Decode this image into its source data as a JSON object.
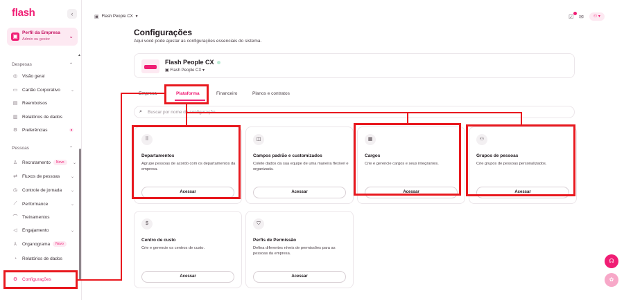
{
  "brand": {
    "logo": "flash",
    "accent": "#f01d74",
    "highlight": "#e8181e"
  },
  "sidebar": {
    "collapse_label": "‹",
    "profile": {
      "name": "Perfil da Empresa",
      "role": "Admin ou gestor"
    },
    "sections": [
      {
        "title": "Despesas",
        "items": [
          {
            "label": "Visão geral",
            "icon": "eye-icon"
          },
          {
            "label": "Cartão Corporativo",
            "icon": "card-icon",
            "has_chevron": true
          },
          {
            "label": "Reembolsos",
            "icon": "receipt-icon"
          },
          {
            "label": "Relatórios de dados",
            "icon": "report-icon"
          },
          {
            "label": "Preferências",
            "icon": "preferences-icon",
            "has_dot": true
          }
        ]
      },
      {
        "title": "Pessoas",
        "items": [
          {
            "label": "Recrutamento",
            "icon": "recruit-icon",
            "badge": "Novo",
            "has_chevron": true
          },
          {
            "label": "Fluxos de pessoas",
            "icon": "flow-icon",
            "has_chevron": true
          },
          {
            "label": "Controle de jornada",
            "icon": "clock-icon",
            "has_chevron": true
          },
          {
            "label": "Performance",
            "icon": "performance-icon",
            "has_chevron": true
          },
          {
            "label": "Treinamentos",
            "icon": "training-icon"
          },
          {
            "label": "Engajamento",
            "icon": "engagement-icon",
            "has_chevron": true
          },
          {
            "label": "Organograma",
            "icon": "org-icon",
            "badge": "Novo"
          },
          {
            "label": "Relatórios de dados",
            "icon": "report-icon"
          }
        ]
      }
    ],
    "active_item": {
      "label": "Configurações",
      "icon": "gear-icon"
    }
  },
  "topbar": {
    "company_selector": "Flash People CX",
    "avatar": "⚇ ▾"
  },
  "main": {
    "title": "Configurações",
    "subtitle": "Aqui você pode ajustar as configurações essenciais do sistema.",
    "company": {
      "name": "Flash People CX",
      "selector": "Flash People CX"
    },
    "tabs": [
      {
        "label": "Empresa",
        "active": false
      },
      {
        "label": "Plataforma",
        "active": true
      },
      {
        "label": "Financeiro",
        "active": false
      },
      {
        "label": "Planos e contratos",
        "active": false
      }
    ],
    "search_placeholder": "Buscar por nome da configuração",
    "cards": [
      {
        "icon": "grid-icon",
        "title": "Departamentos",
        "desc": "Agrupe pessoas de acordo com os departamentos da empresa.",
        "button": "Acessar"
      },
      {
        "icon": "fields-icon",
        "title": "Campos padrão e customizados",
        "desc": "Colete dados da sua equipe de uma maneira flexível e organizada.",
        "button": "Acessar"
      },
      {
        "icon": "briefcase-icon",
        "title": "Cargos",
        "desc": "Crie e gerencie cargos e seus integrantes.",
        "button": "Acessar"
      },
      {
        "icon": "people-icon",
        "title": "Grupos de pessoas",
        "desc": "Crie grupos de pessoas personalizados.",
        "button": "Acessar"
      },
      {
        "icon": "coin-icon",
        "title": "Centro de custo",
        "desc": "Crie e gerencie os centros de custo.",
        "button": "Acessar"
      },
      {
        "icon": "shield-icon",
        "title": "Perfis de Permissão",
        "desc": "Defina diferentes níveis de permissões para as pessoas da empresa.",
        "button": "Acessar"
      }
    ]
  }
}
